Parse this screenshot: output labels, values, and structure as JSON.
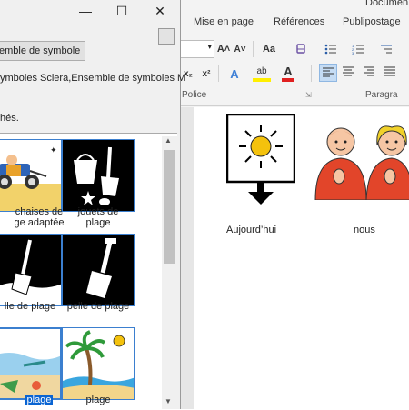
{
  "word": {
    "title": "Documen",
    "tabs": [
      "Mise en page",
      "Références",
      "Publipostage"
    ],
    "group_police": "Police",
    "group_paragraph": "Paragra",
    "ribbon_buttons": {
      "font_dropdown": "▾",
      "grow_font": "A˄",
      "shrink_font": "A˅",
      "change_case": "Aa",
      "clear_format": "✒",
      "subscript": "x₂",
      "superscript": "x²",
      "text_effects": "A",
      "highlight": "ab",
      "font_color": "A",
      "bullets": "☰",
      "numbering": "☰",
      "multilevel": "☰"
    },
    "document": {
      "captions": [
        "Aujourd’hui",
        "nous"
      ]
    }
  },
  "dialog": {
    "window_controls": {
      "minimize": "—",
      "maximize": "☐",
      "close": "✕"
    },
    "symbol_set_button": "emble de symbole",
    "symbol_sets_text": "ymboles Sclera,Ensemble de symboles M",
    "selected_note": "hés.",
    "items": [
      {
        "label": "chaises de\nge adaptée"
      },
      {
        "label": "jouets de\nplage"
      },
      {
        "label": "lle de plage"
      },
      {
        "label": "pelle de plage"
      },
      {
        "label": "plage"
      },
      {
        "label": "plage"
      }
    ]
  },
  "colors": {
    "accent": "#3b7fcf",
    "selection": "#0a64d2",
    "sun": "#f4c20d"
  }
}
